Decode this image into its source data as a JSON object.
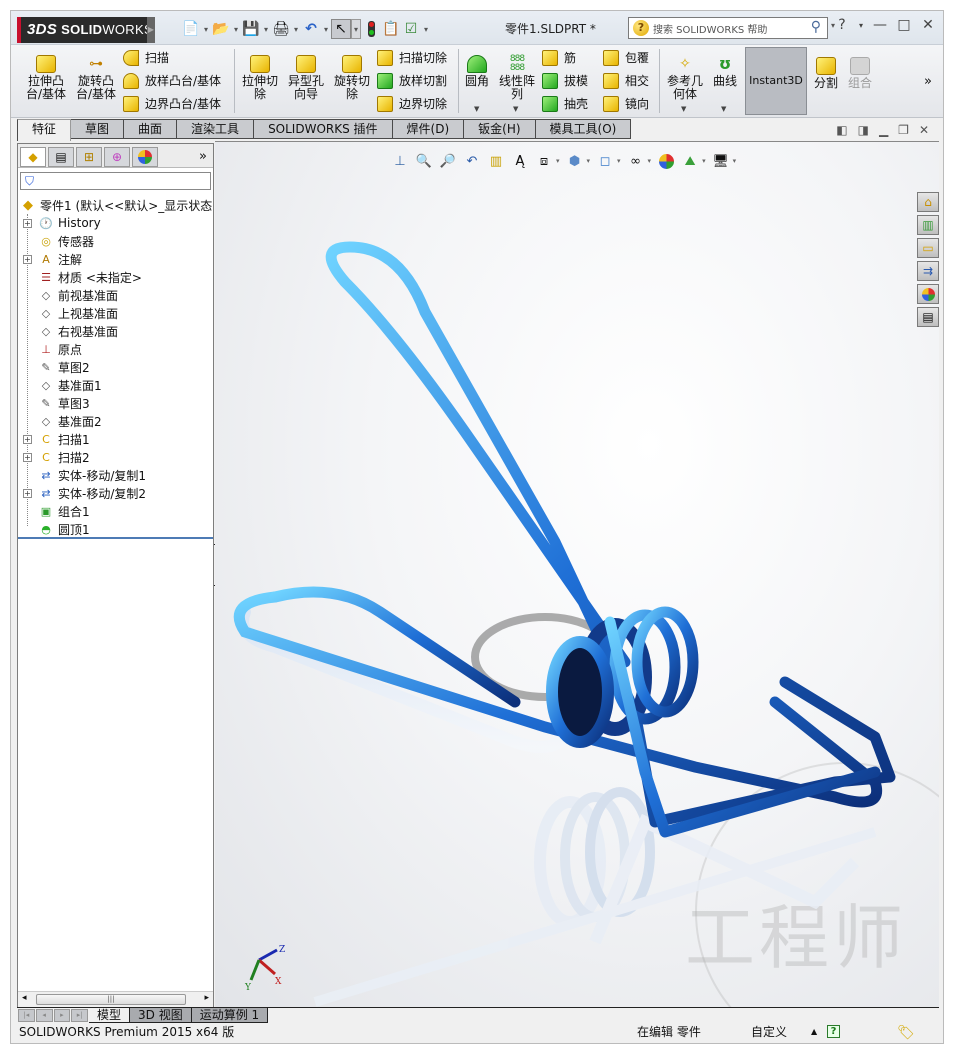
{
  "app": {
    "brand": {
      "ds": "3DS",
      "solid": "SOLID",
      "works": "WORKS"
    },
    "document_title": "零件1.SLDPRT *",
    "help_search_placeholder": "搜索 SOLIDWORKS 帮助",
    "quick_access": [
      {
        "icon": "new-document-icon"
      },
      {
        "icon": "open-folder-icon"
      },
      {
        "icon": "save-icon"
      },
      {
        "icon": "print-icon"
      },
      {
        "icon": "undo-icon"
      },
      {
        "icon": "select-cursor-icon"
      },
      {
        "icon": "rebuild-traffic-light-icon"
      },
      {
        "icon": "file-properties-icon"
      },
      {
        "icon": "options-icon"
      }
    ],
    "window_controls": {
      "help": "?",
      "minimize": "—",
      "restore": "□",
      "close": "✕"
    }
  },
  "command_manager": {
    "features": {
      "extrude_boss": "拉伸凸\n台/基体",
      "revolve_boss": "旋转凸\n台/基体",
      "sweep": "扫描",
      "loft": "放样凸台/基体",
      "boundary_boss": "边界凸台/基体",
      "extrude_cut": "拉伸切\n除",
      "hole_wizard": "异型孔\n向导",
      "revolve_cut": "旋转切\n除",
      "swept_cut": "扫描切除",
      "lofted_cut": "放样切割",
      "boundary_cut": "边界切除",
      "fillet": "圆角",
      "linear_pattern": "线性阵\n列",
      "rib": "筋",
      "draft": "拔模",
      "shell": "抽壳",
      "wrap": "包覆",
      "intersect": "相交",
      "mirror": "镜向",
      "reference_geometry": "参考几\n何体",
      "curves": "曲线",
      "instant3d": "Instant3D",
      "split": "分割",
      "combine": "组合",
      "more": "»"
    }
  },
  "tabs": [
    {
      "label": "特征",
      "active": true
    },
    {
      "label": "草图",
      "active": false
    },
    {
      "label": "曲面",
      "active": false
    },
    {
      "label": "渲染工具",
      "active": false
    },
    {
      "label": "SOLIDWORKS 插件",
      "active": false
    },
    {
      "label": "焊件(D)",
      "active": false
    },
    {
      "label": "钣金(H)",
      "active": false
    },
    {
      "label": "模具工具(O)",
      "active": false
    }
  ],
  "feature_manager": {
    "panel_tabs": [
      {
        "icon": "featuremanager-tree-icon"
      },
      {
        "icon": "propertymanager-icon"
      },
      {
        "icon": "configurationmanager-icon"
      },
      {
        "icon": "dimxpertmanager-icon"
      },
      {
        "icon": "displaymanager-icon"
      }
    ],
    "more": "»",
    "filter_icon": "filter-icon",
    "root": "零件1  (默认<<默认>_显示状态",
    "items": [
      {
        "label": "History",
        "icon": "history-folder-icon",
        "expandable": true
      },
      {
        "label": "传感器",
        "icon": "sensors-folder-icon",
        "expandable": false
      },
      {
        "label": "注解",
        "icon": "annotations-folder-icon",
        "expandable": true
      },
      {
        "label": "材质 <未指定>",
        "icon": "material-icon",
        "expandable": false
      },
      {
        "label": "前视基准面",
        "icon": "plane-icon",
        "expandable": false
      },
      {
        "label": "上视基准面",
        "icon": "plane-icon",
        "expandable": false
      },
      {
        "label": "右视基准面",
        "icon": "plane-icon",
        "expandable": false
      },
      {
        "label": "原点",
        "icon": "origin-icon",
        "expandable": false
      },
      {
        "label": "草图2",
        "icon": "sketch-icon",
        "expandable": false
      },
      {
        "label": "基准面1",
        "icon": "plane-icon",
        "expandable": false
      },
      {
        "label": "草图3",
        "icon": "sketch-icon",
        "expandable": false
      },
      {
        "label": "基准面2",
        "icon": "plane-icon",
        "expandable": false
      },
      {
        "label": "扫描1",
        "icon": "sweep-feature-icon",
        "expandable": true
      },
      {
        "label": "扫描2",
        "icon": "sweep-feature-icon",
        "expandable": true
      },
      {
        "label": "实体-移动/复制1",
        "icon": "move-copy-body-icon",
        "expandable": false
      },
      {
        "label": "实体-移动/复制2",
        "icon": "move-copy-body-icon",
        "expandable": true
      },
      {
        "label": "组合1",
        "icon": "combine-icon",
        "expandable": false
      },
      {
        "label": "圆顶1",
        "icon": "dome-icon",
        "expandable": false
      }
    ]
  },
  "viewport": {
    "heads_up_toolbar": [
      "view-orientation-icon",
      "zoom-to-fit-icon",
      "zoom-to-area-icon",
      "previous-view-icon",
      "section-view-icon",
      "dynamic-annotation-icon",
      "view-orientation-box-icon",
      "display-style-icon",
      "hide-show-items-icon",
      "view-settings-icon",
      "edit-appearance-icon",
      "apply-scene-icon",
      "display-pane-icon"
    ],
    "doc_controls": [
      "tile-left-icon",
      "tile-right-icon",
      "minimize-icon",
      "restore-icon",
      "close-icon"
    ],
    "task_pane": [
      "solidworks-resources-icon",
      "design-library-icon",
      "file-explorer-icon",
      "view-palette-icon",
      "appearances-scenes-icon",
      "custom-properties-icon"
    ],
    "triad": {
      "x": "X",
      "y": "Y",
      "z": "Z"
    },
    "watermark": "工程师",
    "model_color": "#1f6fd6"
  },
  "model_tabs": [
    {
      "label": "模型",
      "active": true
    },
    {
      "label": "3D 视图",
      "active": false
    },
    {
      "label": "运动算例 1",
      "active": false
    }
  ],
  "status_bar": {
    "product": "SOLIDWORKS Premium 2015 x64 版",
    "editing": "在编辑 零件",
    "units": "自定义",
    "up_arrow": "▲",
    "quick_help": "?"
  }
}
